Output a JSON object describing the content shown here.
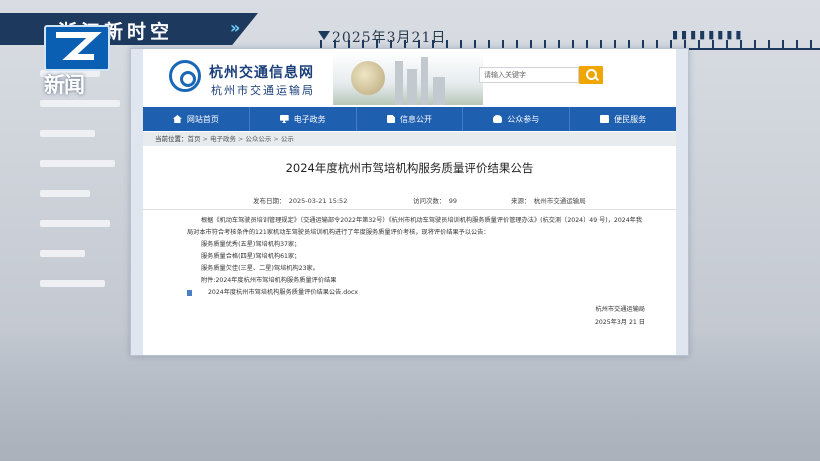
{
  "broadcast": {
    "program_title": "浙江新时空",
    "date": "2025年3月21日",
    "logo_text": "新闻"
  },
  "site": {
    "name": "杭州交通信息网",
    "subtitle": "杭州市交通运输局",
    "search": {
      "placeholder": "请输入关键字"
    },
    "nav": [
      {
        "label": "网站首页",
        "icon": "home-icon"
      },
      {
        "label": "电子政务",
        "icon": "monitor-icon"
      },
      {
        "label": "信息公开",
        "icon": "document-icon"
      },
      {
        "label": "公众参与",
        "icon": "people-icon"
      },
      {
        "label": "便民服务",
        "icon": "service-icon"
      }
    ],
    "breadcrumb": {
      "label": "当前位置：",
      "items": [
        "首页",
        "电子政务",
        "公众公示",
        "公示"
      ]
    }
  },
  "article": {
    "title": "2024年度杭州市驾培机构服务质量评价结果公告",
    "publish_time": "发布日期：　2025-03-21 15:52",
    "views": "访问次数：　99",
    "source": "来源：　杭州市交通运输局",
    "paragraph_1": "根据《机动车驾驶员培训管理规定》（交通运输部令2022年第32号）《杭州市机动车驾驶员培训机构服务质量评价管理办法》(杭交测〔2024〕49 号)，2024年我局对本市符合考核条件的121家机动车驾驶员培训机构进行了年度服务质量评价考核，现将评价结果予以公告：",
    "line_excellent": "服务质量优秀(五星)驾培机构37家；",
    "line_qualified": "服务质量合格(四星)驾培机构61家；",
    "line_poor": "服务质量欠佳(三星、二星)驾培机构23家。",
    "attachment_label": "附件:2024年度杭州市驾培机构服务质量评价结果",
    "attachment_file": "2024年度杭州市驾培机构服务质量评价结果公告.docx",
    "signature_org": "杭州市交通运输局",
    "signature_date": "2025年3月 21 日"
  },
  "colors": {
    "nav_blue": "#1f5fb0",
    "banner_navy": "#1d3a5e",
    "search_orange": "#f0a500"
  }
}
